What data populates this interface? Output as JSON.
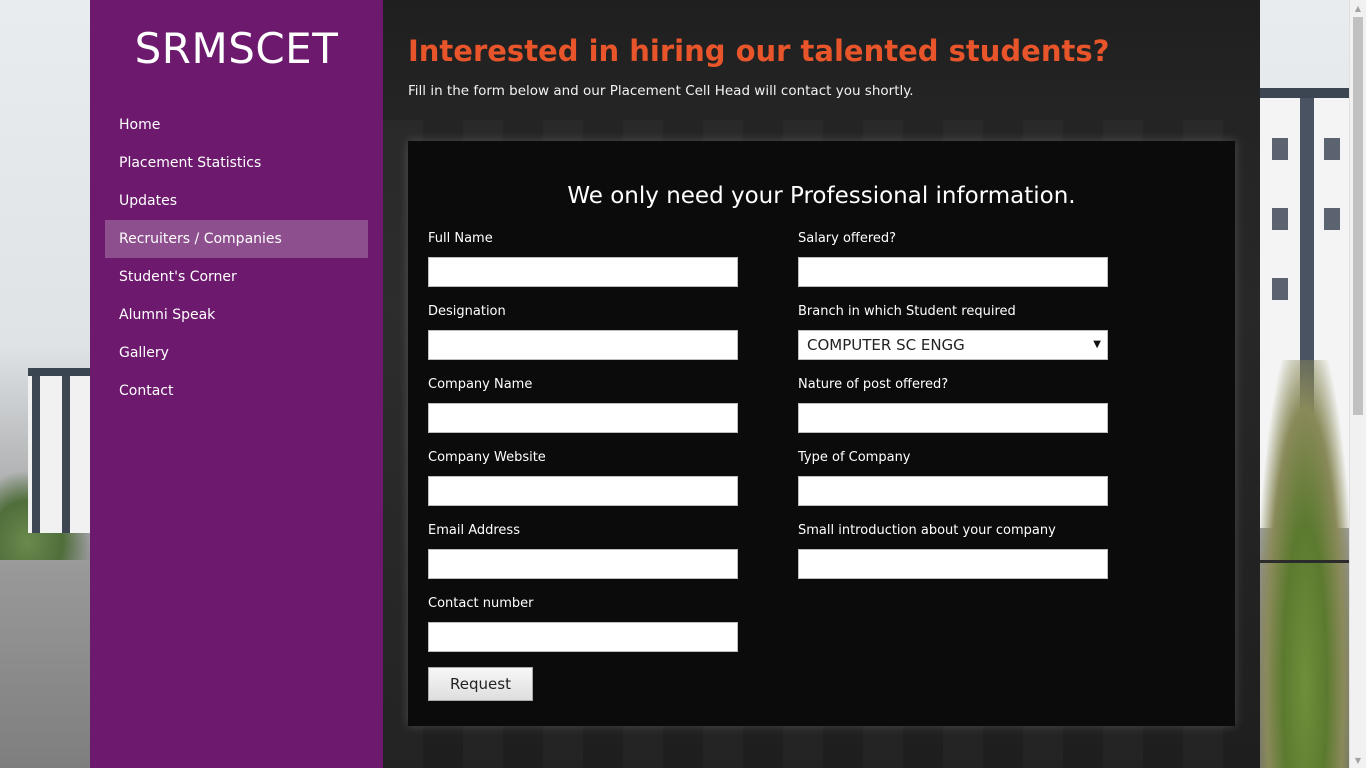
{
  "site": {
    "brand": "SRMSCET"
  },
  "sidebar": {
    "items": [
      {
        "label": "Home"
      },
      {
        "label": "Placement Statistics"
      },
      {
        "label": "Updates"
      },
      {
        "label": "Recruiters / Companies",
        "active": true
      },
      {
        "label": "Student's Corner"
      },
      {
        "label": "Alumni Speak"
      },
      {
        "label": "Gallery"
      },
      {
        "label": "Contact"
      }
    ]
  },
  "main": {
    "headline": "Interested in hiring our talented students?",
    "subline": "Fill in the form below and our Placement Cell Head will contact you shortly.",
    "form": {
      "title": "We only need your Professional information.",
      "left": [
        {
          "label": "Full Name",
          "value": "",
          "placeholder": ""
        },
        {
          "label": "Designation",
          "value": "",
          "placeholder": ""
        },
        {
          "label": "Company Name",
          "value": "",
          "placeholder": ""
        },
        {
          "label": "Company Website",
          "value": "",
          "placeholder": ""
        },
        {
          "label": "Email Address",
          "value": "",
          "placeholder": ""
        },
        {
          "label": "Contact number",
          "value": "",
          "placeholder": ""
        }
      ],
      "right": [
        {
          "label": "Salary offered?",
          "value": "",
          "placeholder": ""
        },
        {
          "label": "Branch in which Student required",
          "selected": "COMPUTER SC ENGG"
        },
        {
          "label": "Nature of post offered?",
          "value": "",
          "placeholder": ""
        },
        {
          "label": "Type of Company",
          "value": "",
          "placeholder": ""
        },
        {
          "label": "Small introduction about your company",
          "value": "",
          "placeholder": ""
        }
      ],
      "submit_label": "Request"
    }
  },
  "colors": {
    "sidebar_bg": "#6d1a6e",
    "sidebar_active": "#8d4f8e",
    "headline": "#e8552a",
    "form_bg": "#0b0b0b"
  }
}
